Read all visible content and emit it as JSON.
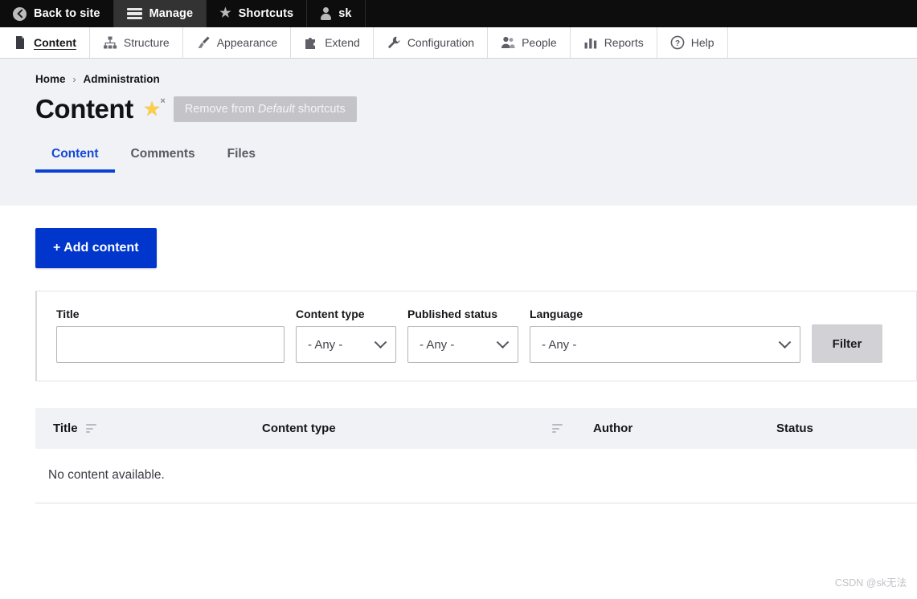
{
  "toolbar": {
    "items": [
      {
        "label": "Back to site",
        "icon": "back-arrow-icon",
        "active": false
      },
      {
        "label": "Manage",
        "icon": "hamburger-icon",
        "active": true
      },
      {
        "label": "Shortcuts",
        "icon": "star-icon",
        "active": false
      },
      {
        "label": "sk",
        "icon": "user-icon",
        "active": false
      }
    ]
  },
  "menu": {
    "items": [
      {
        "label": "Content",
        "icon": "page-icon",
        "active": true
      },
      {
        "label": "Structure",
        "icon": "sitemap-icon",
        "active": false
      },
      {
        "label": "Appearance",
        "icon": "paintbrush-icon",
        "active": false
      },
      {
        "label": "Extend",
        "icon": "puzzle-piece-icon",
        "active": false
      },
      {
        "label": "Configuration",
        "icon": "wrench-icon",
        "active": false
      },
      {
        "label": "People",
        "icon": "people-icon",
        "active": false
      },
      {
        "label": "Reports",
        "icon": "bar-chart-icon",
        "active": false
      },
      {
        "label": "Help",
        "icon": "question-mark-icon",
        "active": false
      }
    ]
  },
  "breadcrumb": {
    "home": "Home",
    "separator": "›",
    "current": "Administration"
  },
  "header": {
    "title": "Content",
    "shortcut_prefix": "Remove from ",
    "shortcut_emphasis": "Default",
    "shortcut_suffix": " shortcuts",
    "star_remove_mark": "×"
  },
  "tabs": [
    {
      "label": "Content",
      "active": true
    },
    {
      "label": "Comments",
      "active": false
    },
    {
      "label": "Files",
      "active": false
    }
  ],
  "actions": {
    "add_content": "+ Add content"
  },
  "filters": {
    "title": {
      "label": "Title",
      "value": "",
      "placeholder": ""
    },
    "content_type": {
      "label": "Content type",
      "value": "- Any -"
    },
    "published_status": {
      "label": "Published status",
      "value": "- Any -"
    },
    "language": {
      "label": "Language",
      "value": "- Any -"
    },
    "submit": "Filter"
  },
  "table": {
    "columns": [
      {
        "label": "Title",
        "sortable": true
      },
      {
        "label": "Content type",
        "sortable": true
      },
      {
        "label": "Author",
        "sortable": false
      },
      {
        "label": "Status",
        "sortable": false
      }
    ],
    "rows": [],
    "empty_message": "No content available."
  },
  "watermark": "CSDN @sk无法",
  "colors": {
    "toolbar_bg": "#0d0d0d",
    "toolbar_active_bg": "#333333",
    "accent_blue": "#0036cc",
    "tab_active_blue": "#1348d8",
    "header_bg": "#f0f2f6",
    "filter_btn_bg": "#d2d2d6",
    "star_gold": "#fdce44"
  }
}
